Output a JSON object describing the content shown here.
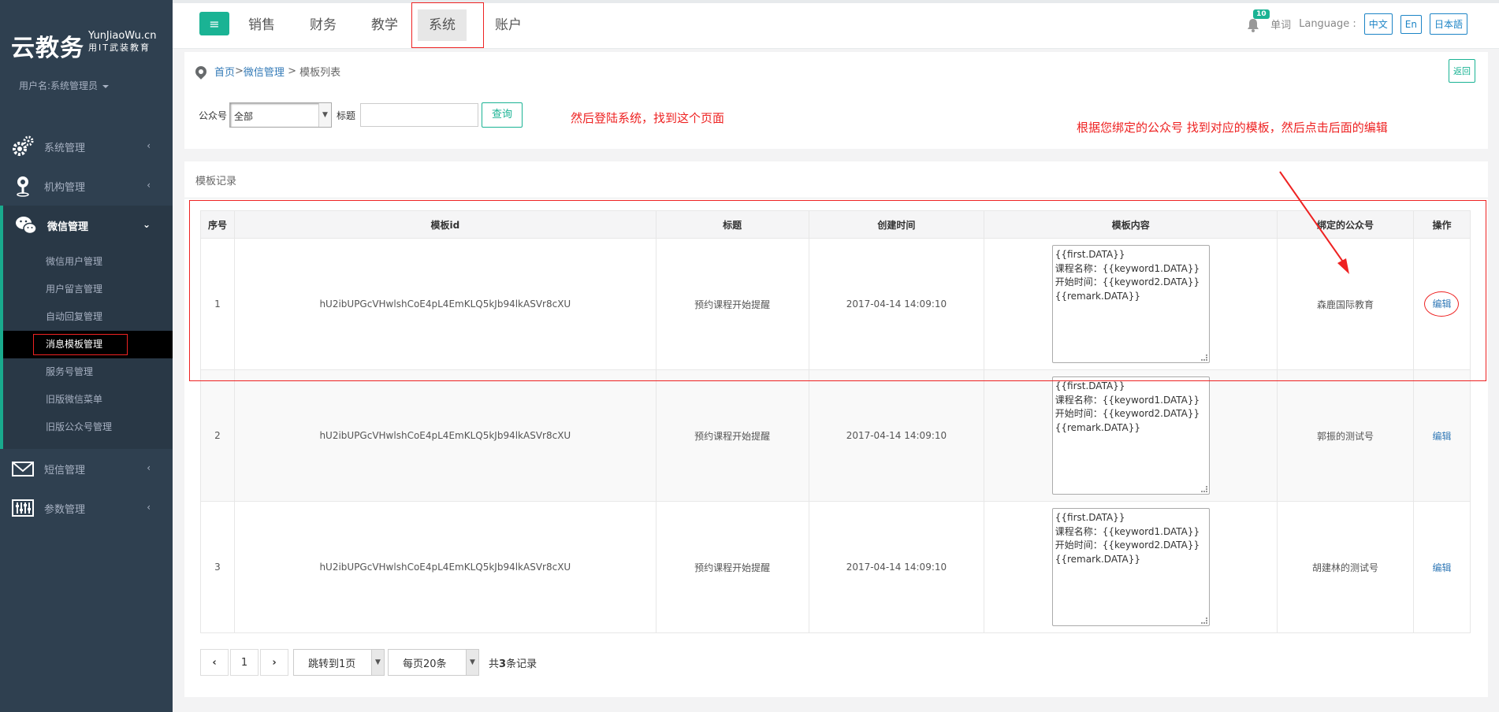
{
  "logo": {
    "cn": "云教务",
    "en_line1": "YunJiaoWu.cn",
    "en_line2": "用IT武装教育"
  },
  "user": {
    "label": "用户名:系统管理员"
  },
  "sidebar": {
    "items": [
      {
        "label": "系统管理",
        "icon": "gears-icon"
      },
      {
        "label": "机构管理",
        "icon": "map-pin-icon"
      },
      {
        "label": "微信管理",
        "icon": "wechat-icon"
      },
      {
        "label": "短信管理",
        "icon": "envelope-icon"
      },
      {
        "label": "参数管理",
        "icon": "sliders-icon"
      }
    ],
    "wechat_sub": [
      "微信用户管理",
      "用户留言管理",
      "自动回复管理",
      "消息模板管理",
      "服务号管理",
      "旧版微信菜单",
      "旧版公众号管理"
    ]
  },
  "topnav": {
    "tabs": [
      "销售",
      "财务",
      "教学",
      "系统",
      "账户"
    ],
    "active_tab": "系统",
    "badge_count": "10",
    "word_label": "单词",
    "language_label": "Language :",
    "langs": [
      "中文",
      "En",
      "日本語"
    ]
  },
  "breadcrumb": {
    "home": "首页",
    "sep1": " >",
    "section": "微信管理",
    "sep2": " > ",
    "current": "模板列表"
  },
  "back_button": "返回",
  "filter": {
    "account_label": "公众号",
    "account_value": "全部",
    "title_label": "标题",
    "title_value": "",
    "query_button": "查询"
  },
  "annotations": {
    "note1": "然后登陆系统，找到这个页面",
    "note2": "根据您绑定的公众号 找到对应的模板，然后点击后面的编辑"
  },
  "records": {
    "title": "模板记录",
    "headers": [
      "序号",
      "模板id",
      "标题",
      "创建时间",
      "模板内容",
      "绑定的公众号",
      "操作"
    ],
    "rows": [
      {
        "no": "1",
        "id": "hU2ibUPGcVHwlshCoE4pL4EmKLQ5kJb94lkASVr8cXU",
        "title": "预约课程开始提醒",
        "created": "2017-04-14 14:09:10",
        "content": [
          "{{first.DATA}}",
          "课程名称：{{keyword1.DATA}}",
          "开始时间：{{keyword2.DATA}}",
          "{{remark.DATA}}"
        ],
        "account": "森鹿国际教育",
        "action": "编辑"
      },
      {
        "no": "2",
        "id": "hU2ibUPGcVHwlshCoE4pL4EmKLQ5kJb94lkASVr8cXU",
        "title": "预约课程开始提醒",
        "created": "2017-04-14 14:09:10",
        "content": [
          "{{first.DATA}}",
          "课程名称：{{keyword1.DATA}}",
          "开始时间：{{keyword2.DATA}}",
          "{{remark.DATA}}"
        ],
        "account": "郭振的测试号",
        "action": "编辑"
      },
      {
        "no": "3",
        "id": "hU2ibUPGcVHwlshCoE4pL4EmKLQ5kJb94lkASVr8cXU",
        "title": "预约课程开始提醒",
        "created": "2017-04-14 14:09:10",
        "content": [
          "{{first.DATA}}",
          "课程名称：{{keyword1.DATA}}",
          "开始时间：{{keyword2.DATA}}",
          "{{remark.DATA}}"
        ],
        "account": "胡建林的测试号",
        "action": "编辑"
      }
    ]
  },
  "pager": {
    "page": "1",
    "jump": "跳转到1页",
    "per_page": "每页20条",
    "total_prefix": "共",
    "total_count": "3",
    "total_suffix": "条记录"
  },
  "colors": {
    "sidebar_bg": "#2f4050",
    "accent": "#1ab394",
    "annotation": "#ee2222",
    "link": "#337ab7"
  }
}
